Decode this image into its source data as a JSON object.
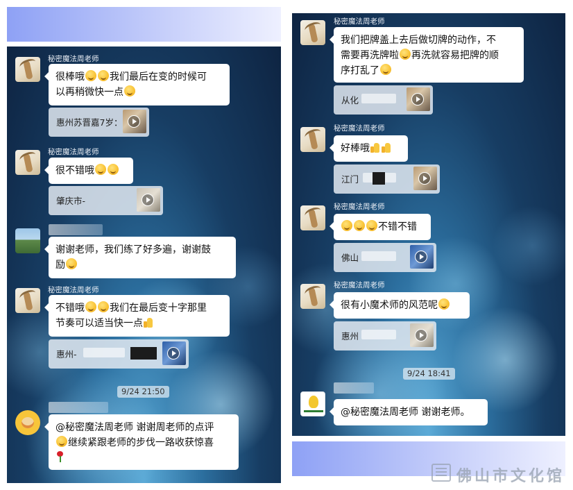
{
  "left_panel": {
    "messages": [
      {
        "sender": "秘密魔法周老师",
        "text_1": "很棒哦",
        "text_2": "我们最后在变的时候可",
        "text_3": "以再稍微快一点",
        "video": {
          "label": "惠州苏晋嘉7岁："
        }
      },
      {
        "sender": "秘密魔法周老师",
        "text": "很不错哦",
        "video": {
          "label": "肇庆市-"
        }
      },
      {
        "text_1": "谢谢老师，我们练了好多遍，谢谢鼓",
        "text_2": "励"
      },
      {
        "sender": "秘密魔法周老师",
        "text_1": "不错哦",
        "text_2": "我们在最后变十字那里",
        "text_3": "节奏可以适当快一点",
        "video": {
          "label": "惠州-"
        }
      },
      {
        "text_1": "@秘密魔法周老师 谢谢周老师的点评",
        "text_2": "继续紧跟老师的步伐一路收获惊喜"
      }
    ],
    "timestamp": "9/24 21:50"
  },
  "right_panel": {
    "messages": [
      {
        "sender": "秘密魔法周老师",
        "text_1": "我们把牌盖上去后做切牌的动作，不",
        "text_2": "需要再洗牌啦",
        "text_3": "再洗就容易把牌的顺",
        "text_4": "序打乱了",
        "video": {
          "label": "从化"
        }
      },
      {
        "sender": "秘密魔法周老师",
        "text": "好棒哦",
        "video": {
          "label": "江门"
        }
      },
      {
        "sender": "秘密魔法周老师",
        "text": "不错不错",
        "video": {
          "label": "佛山"
        }
      },
      {
        "sender": "秘密魔法周老师",
        "text": "很有小魔术师的风范呢",
        "video": {
          "label": "惠州"
        }
      },
      {
        "text": "@秘密魔法周老师 谢谢老师。"
      }
    ],
    "timestamp": "9/24 18:41"
  },
  "watermark": {
    "text": "佛山市文化馆"
  },
  "icons": {
    "emoji": "smiling-face-icon",
    "thumb": "thumbs-up-icon",
    "rose": "rose-icon",
    "play": "play-icon"
  }
}
